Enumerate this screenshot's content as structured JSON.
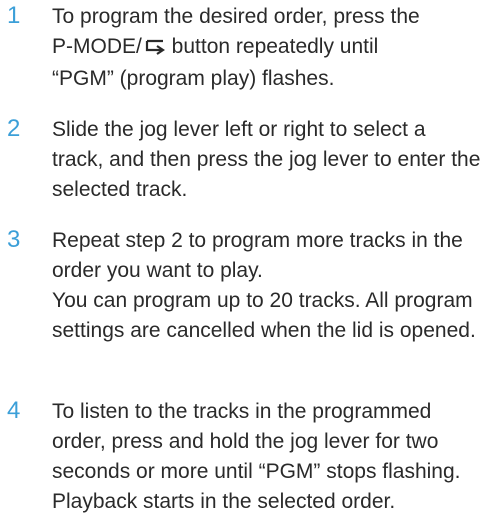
{
  "steps": [
    {
      "number": "1",
      "lines": [
        "To program the desired order, press the",
        "P-MODE/",
        " button repeatedly until",
        "“PGM” (program play) flashes."
      ]
    },
    {
      "number": "2",
      "text": "Slide the jog lever left or right to select a track, and then press the jog lever to enter the selected track."
    },
    {
      "number": "3",
      "text": "Repeat step 2 to program more tracks in the order you want to play.",
      "note": "You can program up to 20 tracks. All program settings are cancelled when the lid is opened."
    },
    {
      "number": "4",
      "text": "To listen to the tracks in the programmed order, press and hold the jog lever for two seconds or more until “PGM” stops flashing.",
      "note": "Playback starts in the selected order."
    }
  ],
  "icons": {
    "repeat": "repeat-icon"
  },
  "colors": {
    "step_number": "#3b9fd8",
    "text": "#2a2a2a"
  }
}
